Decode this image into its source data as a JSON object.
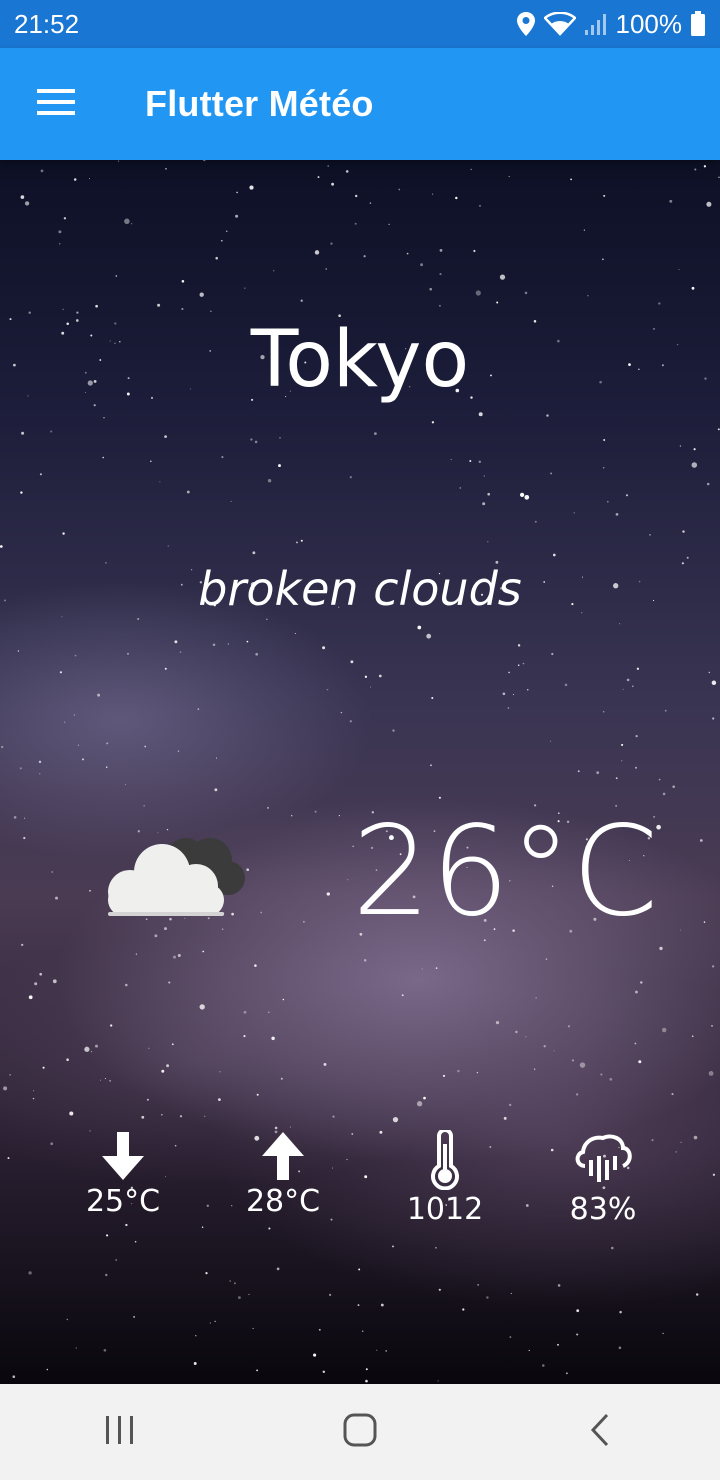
{
  "status_bar": {
    "time": "21:52",
    "battery": "100%",
    "icons": [
      "location-icon",
      "wifi-icon",
      "signal-icon",
      "battery-icon"
    ]
  },
  "app_bar": {
    "title": "Flutter Météo",
    "menu_icon": "menu-icon",
    "color": "#2196f3"
  },
  "weather": {
    "city": "Tokyo",
    "description": "broken clouds",
    "temperature": "26°C",
    "icon": "broken-clouds-icon"
  },
  "stats": [
    {
      "icon": "arrow-down-icon",
      "value": "25°C"
    },
    {
      "icon": "arrow-up-icon",
      "value": "28°C"
    },
    {
      "icon": "thermometer-icon",
      "value": "1012"
    },
    {
      "icon": "rain-cloud-icon",
      "value": "83%"
    }
  ],
  "nav_bar": {
    "buttons": [
      "recent-apps-icon",
      "home-icon",
      "back-icon"
    ]
  }
}
